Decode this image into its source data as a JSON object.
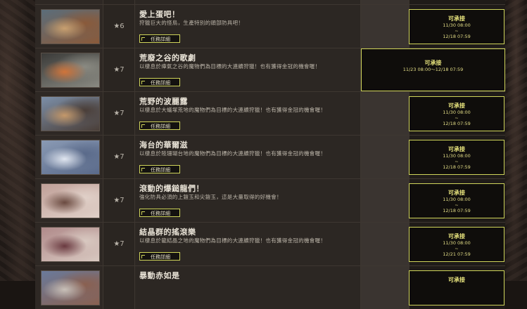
{
  "quests": [
    {
      "stars": "★6",
      "title": "愛上蛋吧！",
      "desc": "狩獵巨大的怪鳥，生產特別的頭部防具吧！",
      "button": "任務詳細",
      "status": "可承接",
      "start": "11/30 08:00",
      "sep": "~",
      "end": "12/18 07:59",
      "thumb_colors": [
        "#5b6d7a",
        "#c8a070",
        "#8a5a3a"
      ]
    },
    {
      "stars": "★7",
      "title": "荒廢之谷的歌劇",
      "desc": "以棲息於瘴氣之谷的魔物們為目標的大連續狩獵！也有獲得金冠的機會喔！",
      "button": "任務詳細",
      "status": "可承接",
      "range": "11/23 08:00～12/18 07:59",
      "thumb_colors": [
        "#3a3a38",
        "#d0743a",
        "#8a8a82"
      ]
    },
    {
      "stars": "★7",
      "title": "荒野的波麗露",
      "desc": "以棲息於大蟻塚荒地的魔物們為目標的大連續狩獵！也有獲得金冠的機會喔！",
      "button": "任務詳細",
      "status": "可承接",
      "start": "11/30 08:00",
      "sep": "~",
      "end": "12/18 07:59",
      "thumb_colors": [
        "#7c8fa8",
        "#c4986a",
        "#4a3e38"
      ]
    },
    {
      "stars": "★7",
      "title": "海台的華爾滋",
      "desc": "以棲息於陸珊瑚台地的魔物們為目標的大連續狩獵！也有獲得金冠的機會喔！",
      "button": "任務詳細",
      "status": "可承接",
      "start": "11/30 08:00",
      "sep": "~",
      "end": "12/18 07:59",
      "thumb_colors": [
        "#8a9ab4",
        "#e0e6f0",
        "#5a6a8a"
      ]
    },
    {
      "stars": "★7",
      "title": "滾動的爆鎚龍們！",
      "desc": "強化防具必須的上鎧玉和尖鎧玉，這是大量取得的好機會！",
      "button": "任務詳細",
      "status": "可承接",
      "start": "11/30 08:00",
      "sep": "~",
      "end": "12/18 07:59",
      "thumb_colors": [
        "#c0a098",
        "#6a4a40",
        "#e0d0c8"
      ]
    },
    {
      "stars": "★7",
      "title": "結晶群的搖滾樂",
      "desc": "以棲息於龍結晶之地的魔物們為目標的大連續狩獵！也有獲得金冠的機會喔！",
      "button": "任務詳細",
      "status": "可承接",
      "start": "11/30 08:00",
      "sep": "~",
      "end": "12/21 07:59",
      "thumb_colors": [
        "#b08a8a",
        "#6a3a40",
        "#d8c8c0"
      ]
    },
    {
      "stars": "",
      "title": "暴動赤如是",
      "desc": "",
      "button": "",
      "status": "可承接",
      "start": "",
      "sep": "",
      "end": "",
      "thumb_colors": [
        "#6a7a9a",
        "#c8c0b8",
        "#8a6050"
      ]
    }
  ]
}
